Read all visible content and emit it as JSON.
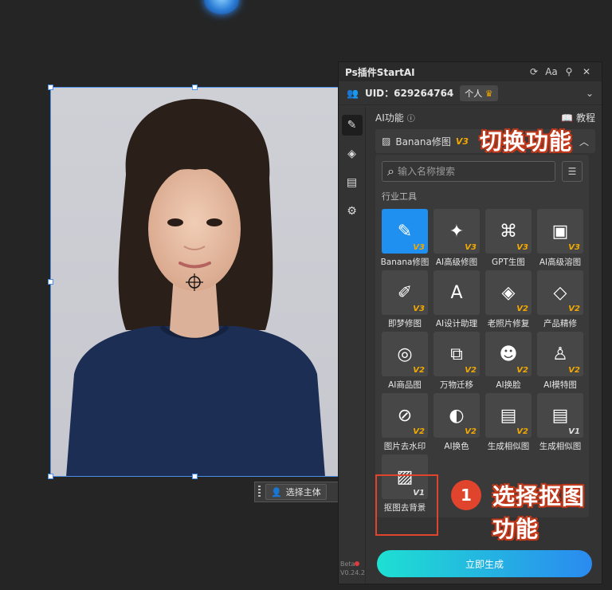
{
  "panel": {
    "title": "Ps插件StartAI",
    "uid_text": "UID：629264764",
    "plan_badge": "个人",
    "section_title": "AI功能",
    "tutorial_label": "教程",
    "selected_tool": "Banana修图",
    "selected_version": "V3",
    "search_placeholder": "输入名称搜索",
    "category": "行业工具",
    "generate_button": "立即生成",
    "beta_label": "Beta",
    "version": "V0.24.2"
  },
  "tools": [
    {
      "label": "Banana修图",
      "version": "V3",
      "icon": "✎"
    },
    {
      "label": "AI高级修图",
      "version": "V3",
      "icon": "✦"
    },
    {
      "label": "GPT生图",
      "version": "V3",
      "icon": "⌘"
    },
    {
      "label": "AI高级溶图",
      "version": "V3",
      "icon": "▣"
    },
    {
      "label": "即梦修图",
      "version": "V3",
      "icon": "✐"
    },
    {
      "label": "AI设计助理",
      "version": "",
      "icon": "A"
    },
    {
      "label": "老照片修复",
      "version": "V2",
      "icon": "◈"
    },
    {
      "label": "产品精修",
      "version": "V2",
      "icon": "◇"
    },
    {
      "label": "AI商品图",
      "version": "V2",
      "icon": "◎"
    },
    {
      "label": "万物迁移",
      "version": "V2",
      "icon": "⧉"
    },
    {
      "label": "AI换脸",
      "version": "V2",
      "icon": "☻"
    },
    {
      "label": "AI模特图",
      "version": "V2",
      "icon": "♙"
    },
    {
      "label": "图片去水印",
      "version": "V2",
      "icon": "⊘"
    },
    {
      "label": "AI换色",
      "version": "V2",
      "icon": "◐"
    },
    {
      "label": "生成相似图",
      "version": "V2",
      "icon": "▤"
    },
    {
      "label": "生成相似图",
      "version": "V1",
      "icon": "▤"
    },
    {
      "label": "抠图去背景",
      "version": "V1",
      "icon": "▨"
    }
  ],
  "canvas": {
    "subject_button": "选择主体"
  },
  "annotations": {
    "switch_label": "切换功能",
    "step_number": "1",
    "step_label_line1": "选择抠图",
    "step_label_line2": "功能"
  },
  "colors": {
    "accent": "#1f8ff0",
    "version_tag": "#f2a800",
    "annotation_red": "#e0442c",
    "generate_start": "#1ee0d2",
    "generate_end": "#2a8af0"
  }
}
